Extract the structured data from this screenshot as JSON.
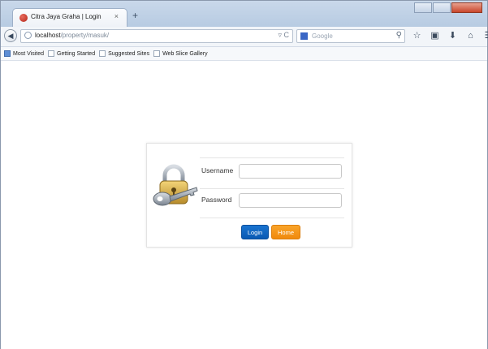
{
  "browser": {
    "tab_title": "Citra Jaya Graha | Login",
    "tab_close": "×",
    "new_tab": "+",
    "url_host": "localhost",
    "url_path": "/property/masuk/",
    "url_right_icons": "▿ C",
    "search_placeholder": "Google",
    "toolbar_icons": [
      "search-icon",
      "star-icon",
      "clipboard-icon",
      "download-icon",
      "home-icon",
      "menu-icon"
    ]
  },
  "bookmarks": [
    {
      "label": "Most Visited"
    },
    {
      "label": "Getting Started"
    },
    {
      "label": "Suggested Sites"
    },
    {
      "label": "Web Slice Gallery"
    }
  ],
  "login": {
    "username_label": "Username",
    "password_label": "Password",
    "username_value": "",
    "password_value": "",
    "login_button": "Login",
    "home_button": "Home"
  },
  "colors": {
    "login_button": "#0a5ab3",
    "home_button": "#f08a0e"
  }
}
